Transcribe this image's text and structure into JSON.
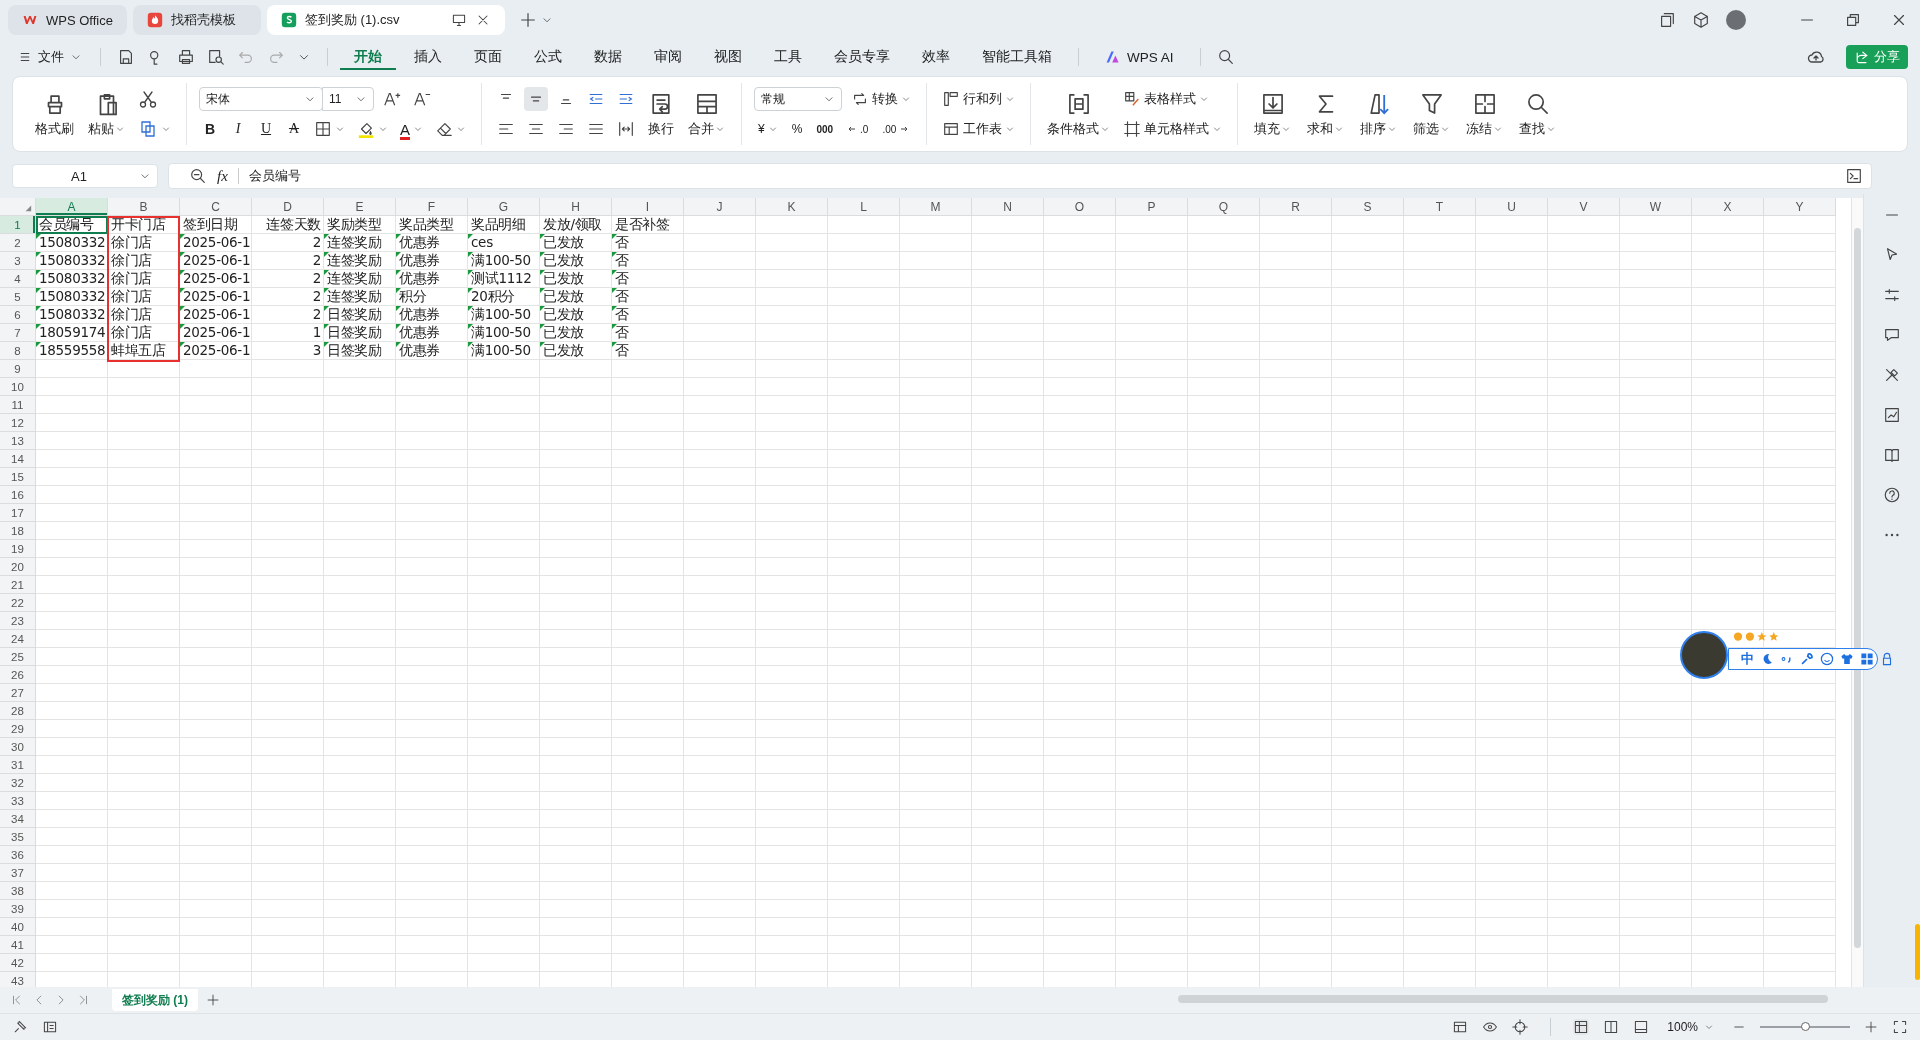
{
  "tabs": [
    {
      "label": "WPS Office",
      "kind": "wps",
      "selected": false
    },
    {
      "label": "找稻壳模板",
      "kind": "docer",
      "selected": false
    },
    {
      "label": "签到奖励 (1).csv",
      "kind": "sheet",
      "selected": true
    }
  ],
  "menu": {
    "file": "文件",
    "tabs": [
      {
        "label": "开始",
        "selected": true
      },
      {
        "label": "插入",
        "selected": false
      },
      {
        "label": "页面",
        "selected": false
      },
      {
        "label": "公式",
        "selected": false
      },
      {
        "label": "数据",
        "selected": false
      },
      {
        "label": "审阅",
        "selected": false
      },
      {
        "label": "视图",
        "selected": false
      },
      {
        "label": "工具",
        "selected": false
      },
      {
        "label": "会员专享",
        "selected": false
      },
      {
        "label": "效率",
        "selected": false
      },
      {
        "label": "智能工具箱",
        "selected": false
      }
    ],
    "ai": "WPS AI",
    "share": "分享"
  },
  "ribbon": {
    "format_painter": "格式刷",
    "paste": "粘贴",
    "font": "宋体",
    "font_size": "11",
    "text_format": [
      {
        "label": "B",
        "kind": "bold"
      },
      {
        "label": "I",
        "kind": "italic"
      },
      {
        "label": "U",
        "kind": "underline"
      },
      {
        "label": "A",
        "kind": "strike"
      }
    ],
    "font_color": "A",
    "wrap": "换行",
    "merge": "合并",
    "number_format": "常规",
    "convert": "转换",
    "number_buttons": [
      {
        "label": "¥",
        "kind": "currency"
      },
      {
        "label": "%",
        "kind": "percent"
      },
      {
        "label": "000",
        "kind": "thousands"
      },
      {
        "label": ".0",
        "kind": "increase"
      },
      {
        "label": ".00",
        "kind": "decrease"
      }
    ],
    "rows_cols": "行和列",
    "worksheet": "工作表",
    "conditional": "条件格式",
    "table_style": "表格样式",
    "cell_style": "单元格样式",
    "tools": [
      {
        "label": "填充",
        "kind": "fill"
      },
      {
        "label": "求和",
        "kind": "sum"
      },
      {
        "label": "排序",
        "kind": "sort"
      },
      {
        "label": "筛选",
        "kind": "filter"
      },
      {
        "label": "冻结",
        "kind": "freeze"
      },
      {
        "label": "查找",
        "kind": "find"
      }
    ]
  },
  "formula_bar": {
    "name_box": "A1",
    "fx": "fx",
    "content": "会员编号"
  },
  "columns": [
    {
      "label": "A",
      "selected": true,
      "kind": "text",
      "annotated": false
    },
    {
      "label": "B",
      "selected": false,
      "kind": "text",
      "annotated": true
    },
    {
      "label": "C",
      "selected": false,
      "kind": "text",
      "annotated": false
    },
    {
      "label": "D",
      "selected": false,
      "kind": "number",
      "annotated": false
    },
    {
      "label": "E",
      "selected": false,
      "kind": "text",
      "annotated": false
    },
    {
      "label": "F",
      "selected": false,
      "kind": "text",
      "annotated": false
    },
    {
      "label": "G",
      "selected": false,
      "kind": "text",
      "annotated": false
    },
    {
      "label": "H",
      "selected": false,
      "kind": "text",
      "annotated": false
    },
    {
      "label": "I",
      "selected": false,
      "kind": "text",
      "annotated": false
    },
    {
      "label": "J",
      "selected": false,
      "annotated": false
    },
    {
      "label": "K",
      "selected": false,
      "annotated": false
    },
    {
      "label": "L",
      "selected": false,
      "annotated": false
    },
    {
      "label": "M",
      "selected": false,
      "annotated": false
    },
    {
      "label": "N",
      "selected": false,
      "annotated": false
    },
    {
      "label": "O",
      "selected": false,
      "annotated": false
    },
    {
      "label": "P",
      "selected": false,
      "annotated": false
    },
    {
      "label": "Q",
      "selected": false,
      "annotated": false
    },
    {
      "label": "R",
      "selected": false,
      "annotated": false
    },
    {
      "label": "S",
      "selected": false,
      "annotated": false
    },
    {
      "label": "T",
      "selected": false,
      "annotated": false
    },
    {
      "label": "U",
      "selected": false,
      "annotated": false
    },
    {
      "label": "V",
      "selected": false,
      "annotated": false
    },
    {
      "label": "W",
      "selected": false,
      "annotated": false
    },
    {
      "label": "X",
      "selected": false,
      "annotated": false
    },
    {
      "label": "Y",
      "selected": false,
      "annotated": false
    }
  ],
  "rows": [
    {
      "label": "1",
      "selected": true,
      "cells": [
        {
          "text": "会员编号",
          "flagged": false
        },
        {
          "text": "开卡门店",
          "flagged": false
        },
        {
          "text": "签到日期",
          "flagged": false
        },
        {
          "text": "连签天数",
          "flagged": false
        },
        {
          "text": "奖励类型",
          "flagged": false
        },
        {
          "text": "奖品类型",
          "flagged": false
        },
        {
          "text": "奖品明细",
          "flagged": false
        },
        {
          "text": "发放/领取",
          "flagged": false
        },
        {
          "text": "是否补签",
          "flagged": false
        }
      ]
    },
    {
      "label": "2",
      "selected": false,
      "cells": [
        {
          "text": "15080332",
          "flagged": true
        },
        {
          "text": "徐门店",
          "flagged": false
        },
        {
          "text": "2025-06-1",
          "flagged": true
        },
        {
          "text": "2",
          "flagged": false
        },
        {
          "text": "连签奖励",
          "flagged": true
        },
        {
          "text": "优惠券",
          "flagged": true
        },
        {
          "text": "ces",
          "flagged": true
        },
        {
          "text": "已发放",
          "flagged": true
        },
        {
          "text": "否",
          "flagged": true
        }
      ]
    },
    {
      "label": "3",
      "selected": false,
      "cells": [
        {
          "text": "15080332",
          "flagged": true
        },
        {
          "text": "徐门店",
          "flagged": false
        },
        {
          "text": "2025-06-1",
          "flagged": true
        },
        {
          "text": "2",
          "flagged": false
        },
        {
          "text": "连签奖励",
          "flagged": true
        },
        {
          "text": "优惠券",
          "flagged": true
        },
        {
          "text": "满100-50",
          "flagged": true
        },
        {
          "text": "已发放",
          "flagged": true
        },
        {
          "text": "否",
          "flagged": true
        }
      ]
    },
    {
      "label": "4",
      "selected": false,
      "cells": [
        {
          "text": "15080332",
          "flagged": true
        },
        {
          "text": "徐门店",
          "flagged": false
        },
        {
          "text": "2025-06-1",
          "flagged": true
        },
        {
          "text": "2",
          "flagged": false
        },
        {
          "text": "连签奖励",
          "flagged": true
        },
        {
          "text": "优惠券",
          "flagged": true
        },
        {
          "text": "测试1112",
          "flagged": true
        },
        {
          "text": "已发放",
          "flagged": true
        },
        {
          "text": "否",
          "flagged": true
        }
      ]
    },
    {
      "label": "5",
      "selected": false,
      "cells": [
        {
          "text": "15080332",
          "flagged": true
        },
        {
          "text": "徐门店",
          "flagged": false
        },
        {
          "text": "2025-06-1",
          "flagged": true
        },
        {
          "text": "2",
          "flagged": false
        },
        {
          "text": "连签奖励",
          "flagged": true
        },
        {
          "text": "积分",
          "flagged": true
        },
        {
          "text": "20积分",
          "flagged": true
        },
        {
          "text": "已发放",
          "flagged": true
        },
        {
          "text": "否",
          "flagged": true
        }
      ]
    },
    {
      "label": "6",
      "selected": false,
      "cells": [
        {
          "text": "15080332",
          "flagged": true
        },
        {
          "text": "徐门店",
          "flagged": false
        },
        {
          "text": "2025-06-1",
          "flagged": true
        },
        {
          "text": "2",
          "flagged": false
        },
        {
          "text": "日签奖励",
          "flagged": true
        },
        {
          "text": "优惠券",
          "flagged": true
        },
        {
          "text": "满100-50",
          "flagged": true
        },
        {
          "text": "已发放",
          "flagged": true
        },
        {
          "text": "否",
          "flagged": true
        }
      ]
    },
    {
      "label": "7",
      "selected": false,
      "cells": [
        {
          "text": "18059174",
          "flagged": true
        },
        {
          "text": "徐门店",
          "flagged": false
        },
        {
          "text": "2025-06-1",
          "flagged": true
        },
        {
          "text": "1",
          "flagged": false
        },
        {
          "text": "日签奖励",
          "flagged": true
        },
        {
          "text": "优惠券",
          "flagged": true
        },
        {
          "text": "满100-50",
          "flagged": true
        },
        {
          "text": "已发放",
          "flagged": true
        },
        {
          "text": "否",
          "flagged": true
        }
      ]
    },
    {
      "label": "8",
      "selected": false,
      "cells": [
        {
          "text": "18559558",
          "flagged": true
        },
        {
          "text": "蚌埠五店",
          "flagged": false
        },
        {
          "text": "2025-06-1",
          "flagged": true
        },
        {
          "text": "3",
          "flagged": false
        },
        {
          "text": "日签奖励",
          "flagged": true
        },
        {
          "text": "优惠券",
          "flagged": true
        },
        {
          "text": "满100-50",
          "flagged": true
        },
        {
          "text": "已发放",
          "flagged": true
        },
        {
          "text": "否",
          "flagged": true
        }
      ]
    },
    {
      "label": "9",
      "selected": false
    },
    {
      "label": "10",
      "selected": false
    },
    {
      "label": "11",
      "selected": false
    },
    {
      "label": "12",
      "selected": false
    },
    {
      "label": "13",
      "selected": false
    },
    {
      "label": "14",
      "selected": false
    },
    {
      "label": "15",
      "selected": false
    },
    {
      "label": "16",
      "selected": false
    },
    {
      "label": "17",
      "selected": false
    },
    {
      "label": "18",
      "selected": false
    },
    {
      "label": "19",
      "selected": false
    },
    {
      "label": "20",
      "selected": false
    },
    {
      "label": "21",
      "selected": false
    },
    {
      "label": "22",
      "selected": false
    },
    {
      "label": "23",
      "selected": false
    },
    {
      "label": "24",
      "selected": false
    },
    {
      "label": "25",
      "selected": false
    },
    {
      "label": "26",
      "selected": false
    },
    {
      "label": "27",
      "selected": false
    },
    {
      "label": "28",
      "selected": false
    },
    {
      "label": "29",
      "selected": false
    },
    {
      "label": "30",
      "selected": false
    },
    {
      "label": "31",
      "selected": false
    },
    {
      "label": "32",
      "selected": false
    },
    {
      "label": "33",
      "selected": false
    },
    {
      "label": "34",
      "selected": false
    },
    {
      "label": "35",
      "selected": false
    },
    {
      "label": "36",
      "selected": false
    },
    {
      "label": "37",
      "selected": false
    },
    {
      "label": "38",
      "selected": false
    },
    {
      "label": "39",
      "selected": false
    },
    {
      "label": "40",
      "selected": false
    },
    {
      "label": "41",
      "selected": false
    },
    {
      "label": "42",
      "selected": false
    },
    {
      "label": "43",
      "selected": false
    }
  ],
  "sheet_tabs": [
    {
      "label": "签到奖励 (1)",
      "selected": true
    }
  ],
  "status_bar": {
    "zoom": "100%",
    "zoom_slider": {
      "level": 0.5
    }
  },
  "input_widget": {
    "mode": "中"
  }
}
